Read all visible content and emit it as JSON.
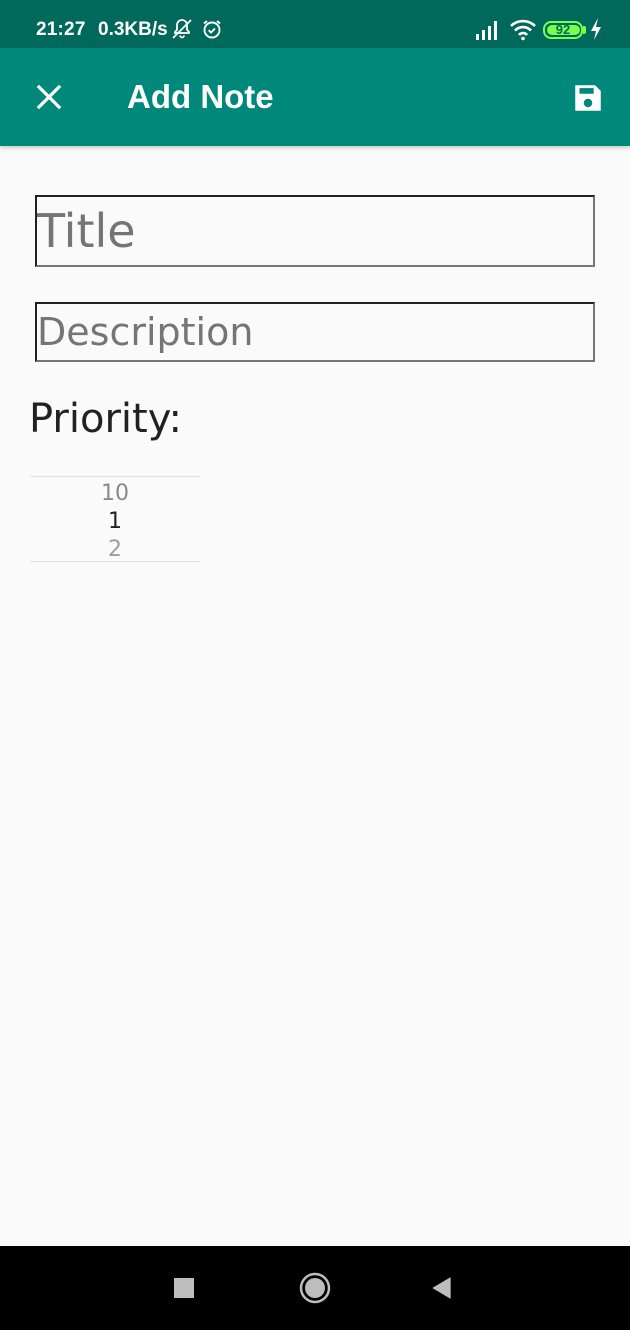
{
  "status_bar": {
    "time": "21:27",
    "net_speed": "0.3KB/s",
    "battery_level": "92",
    "icons": [
      "bell-off-icon",
      "alarm-icon",
      "signal-icon",
      "wifi-icon",
      "battery-icon",
      "charging-bolt-icon"
    ]
  },
  "app_bar": {
    "title": "Add Note",
    "close_icon": "close-icon",
    "save_icon": "save-icon",
    "background": "#00897b",
    "status_background": "#00695c"
  },
  "form": {
    "title_placeholder": "Title",
    "description_placeholder": "Description",
    "priority_label": "Priority:"
  },
  "priority_picker": {
    "previous": "10",
    "current": "1",
    "next": "2"
  },
  "nav_bar": {
    "icons": [
      "recents-icon",
      "home-icon",
      "back-icon"
    ]
  }
}
